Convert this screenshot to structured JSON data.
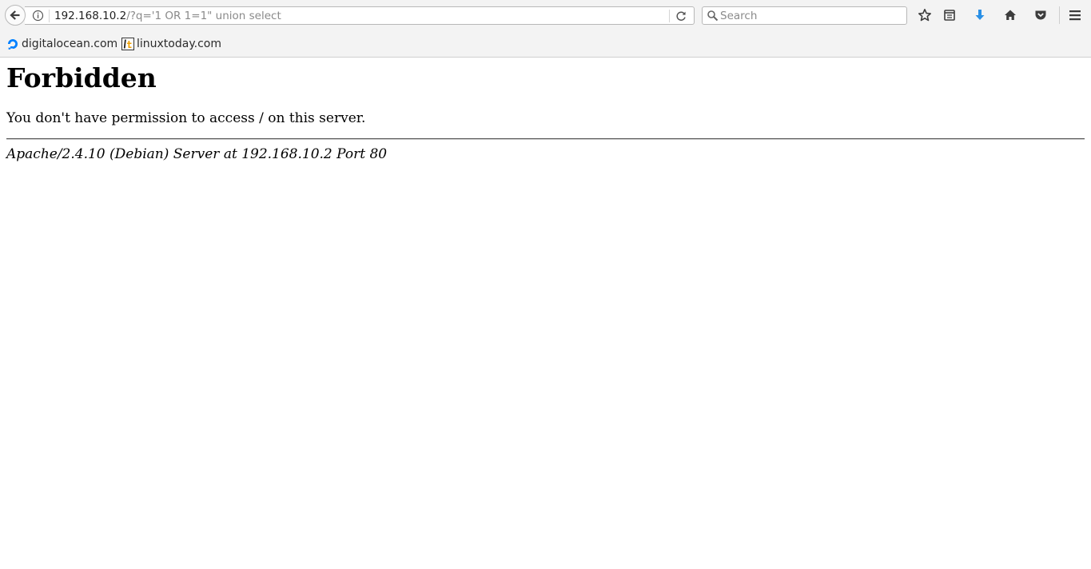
{
  "browser": {
    "url_host": "192.168.10.2",
    "url_rest": "/?q='1 OR 1=1\" union select",
    "search_placeholder": "Search",
    "download_icon_color": "#2a90e6"
  },
  "bookmarks": [
    {
      "label": "digitalocean.com",
      "icon": "digitalocean-icon",
      "color": "#0080ff"
    },
    {
      "label": "linuxtoday.com",
      "icon": "linuxtoday-icon",
      "color": "#f0a000"
    }
  ],
  "page": {
    "title": "Forbidden",
    "message": "You don't have permission to access / on this server.",
    "signature": "Apache/2.4.10 (Debian) Server at 192.168.10.2 Port 80"
  }
}
